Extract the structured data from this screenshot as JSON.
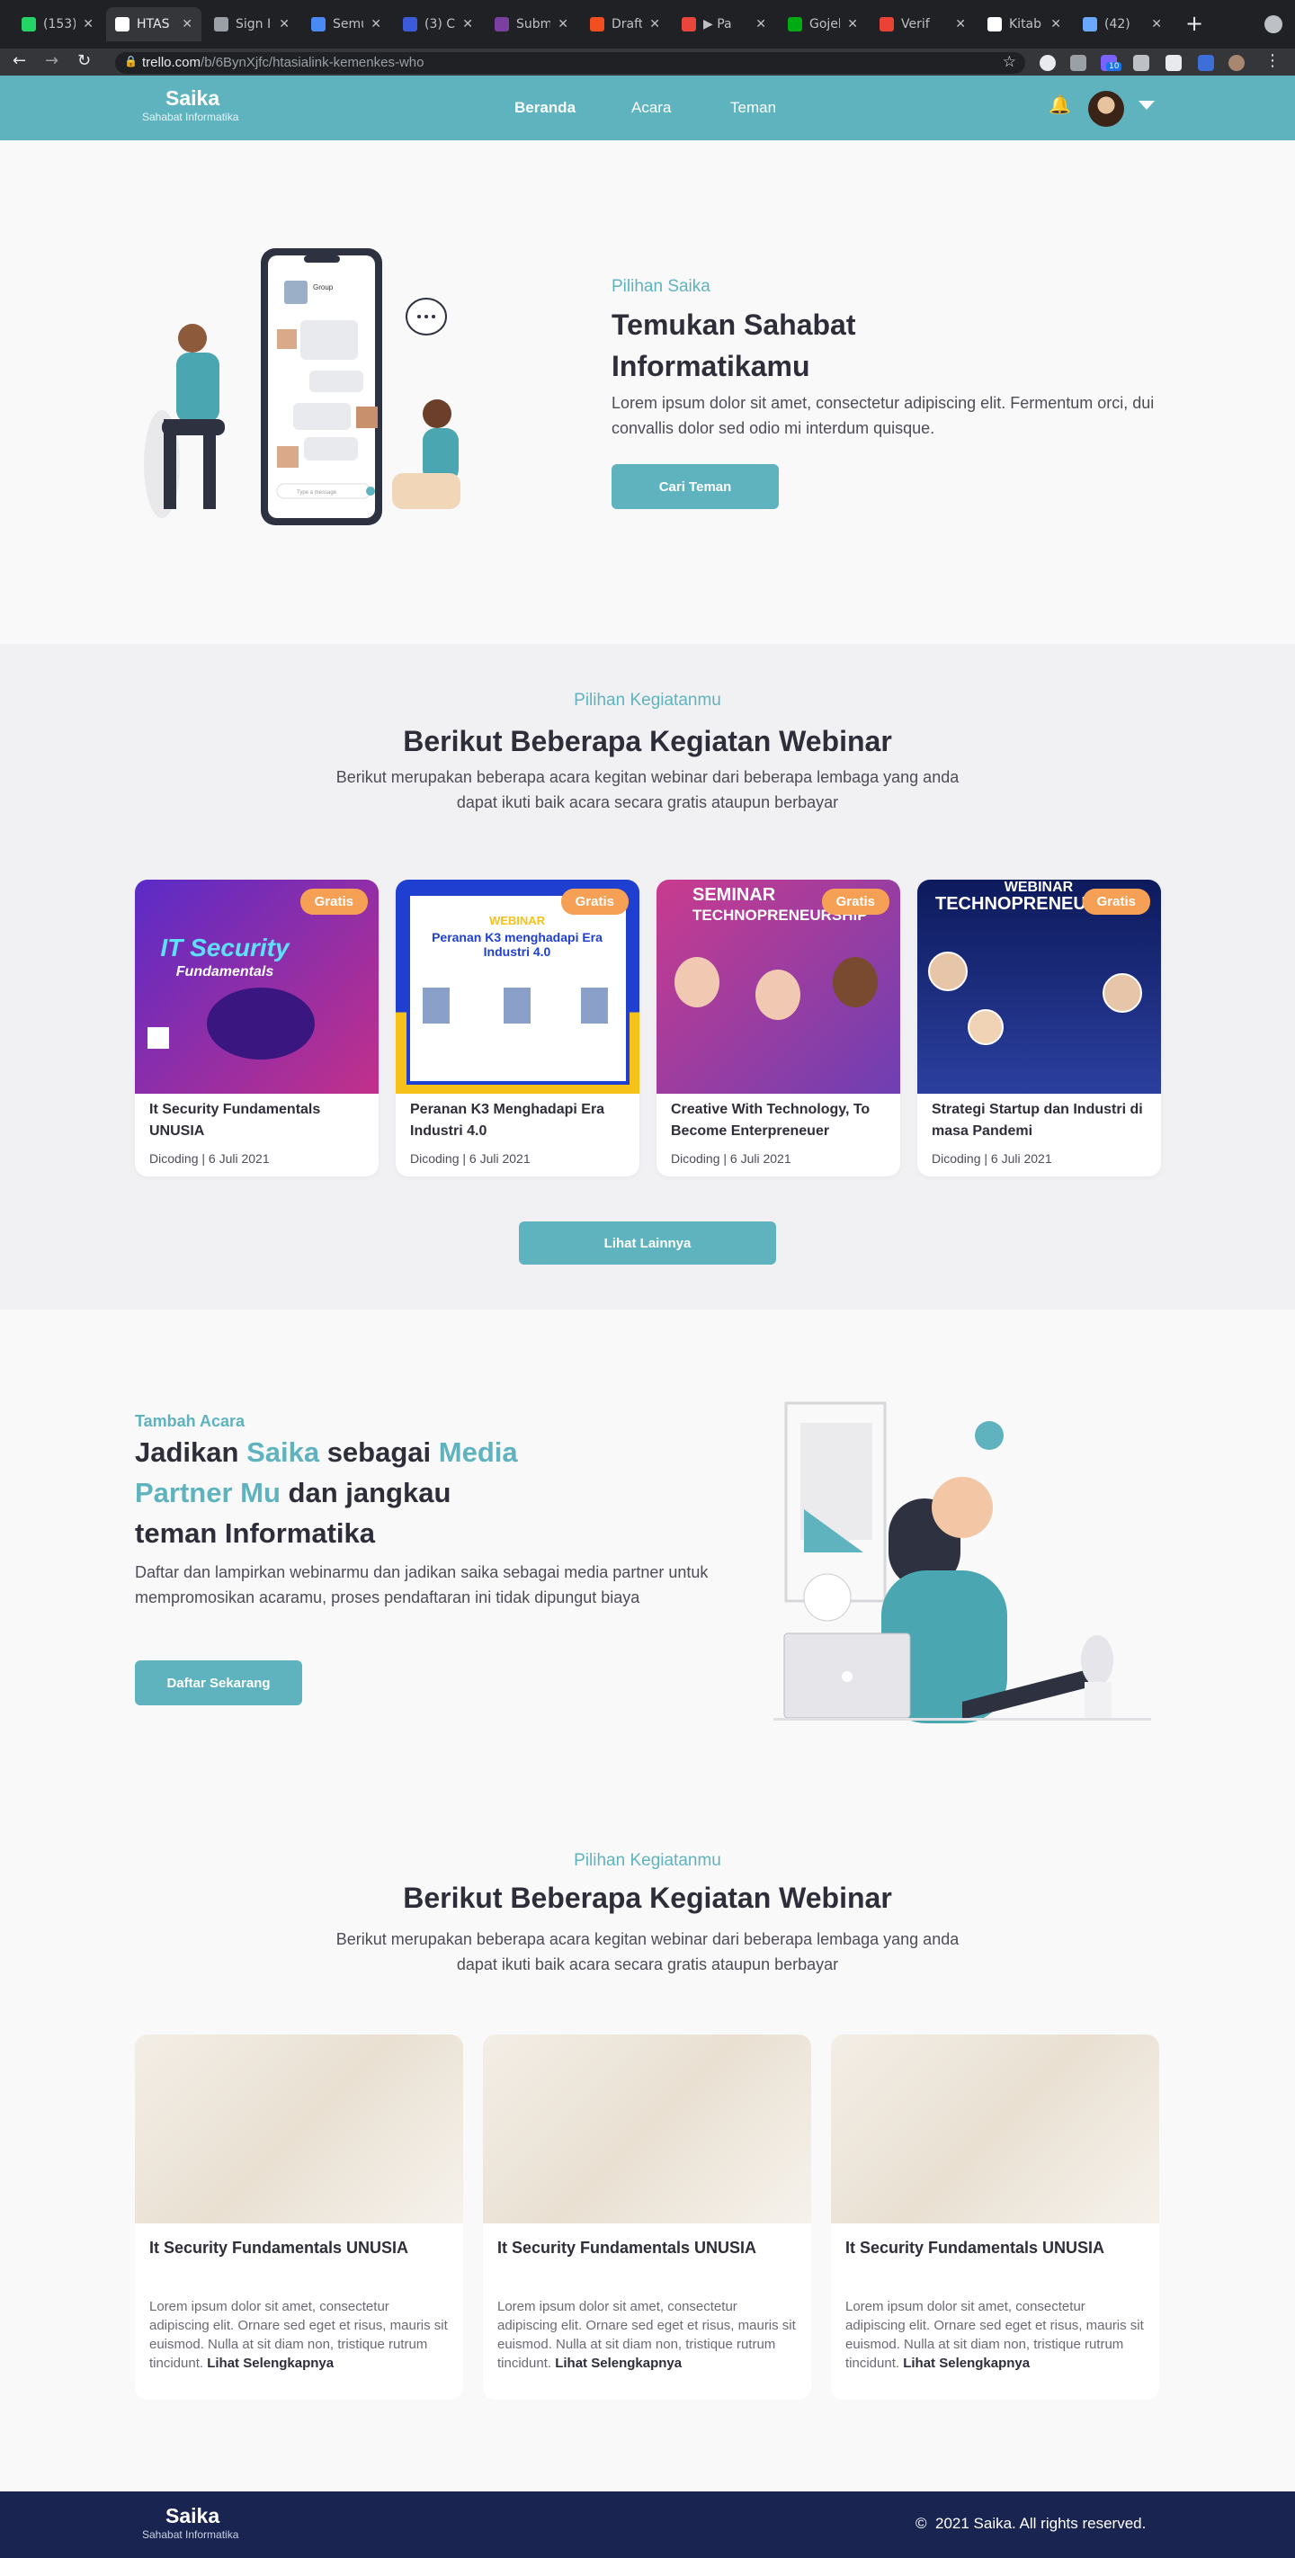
{
  "browser": {
    "tabs": [
      {
        "label": "(153)",
        "color": "#25d366"
      },
      {
        "label": "HTAS",
        "color": "#ffffff"
      },
      {
        "label": "Sign I",
        "color": "#9aa0a6"
      },
      {
        "label": "Semu",
        "color": "#4a8af4"
      },
      {
        "label": "(3) C",
        "color": "#3b5bdb"
      },
      {
        "label": "Subm",
        "color": "#7b3fa0"
      },
      {
        "label": "Draft",
        "color": "#f24e1e"
      },
      {
        "label": "▶ Pa",
        "color": "#e8453c"
      },
      {
        "label": "Gojek",
        "color": "#00aa13"
      },
      {
        "label": "Verif",
        "color": "#ea4335"
      },
      {
        "label": "Kitab",
        "color": "#ffffff"
      },
      {
        "label": "(42)",
        "color": "#6aa9ff"
      }
    ],
    "url_host": "trello.com",
    "url_path": "/b/6BynXjfc/htasialink-kemenkes-who",
    "extension_badge": "10"
  },
  "header": {
    "brand": "Saika",
    "brand_sub": "Sahabat Informatika",
    "nav": [
      "Beranda",
      "Acara",
      "Teman"
    ]
  },
  "hero": {
    "eyebrow": "Pilihan Saika",
    "title_line1": "Temukan Sahabat",
    "title_line2": "Informatikamu",
    "desc": "Lorem ipsum dolor sit amet, consectetur adipiscing elit. Fermentum orci, dui convallis dolor sed odio mi interdum quisque.",
    "cta": "Cari Teman",
    "chat_app_title": "Group",
    "chat_input_placeholder": "Type a message"
  },
  "webinar": {
    "eyebrow": "Pilihan Kegiatanmu",
    "title": "Berikut Beberapa Kegiatan Webinar",
    "desc_line1": "Berikut merupakan beberapa acara kegitan webinar dari beberapa lembaga yang anda",
    "desc_line2": "dapat ikuti baik acara secara gratis ataupun berbayar",
    "badge": "Gratis",
    "cards": [
      {
        "poster_text": "IT Security",
        "poster_sub": "Fundamentals",
        "title": "It Security Fundamentals UNUSIA",
        "meta": "Dicoding | 6 Juli 2021",
        "c1": "#5b2bc7",
        "c2": "#c2308a"
      },
      {
        "poster_text": "WEBINAR",
        "poster_sub": "Peranan K3 menghadapi Era Industri 4.0",
        "title": "Peranan K3 Menghadapi Era Industri 4.0",
        "meta": "Dicoding | 6 Juli 2021",
        "c1": "#1f3fd1",
        "c2": "#f6c21a"
      },
      {
        "poster_text": "SEMINAR",
        "poster_sub": "TECHNOPRENEURSHIP",
        "title": "Creative With Technology, To Become Enterpreneuer",
        "meta": "Dicoding | 6 Juli 2021",
        "c1": "#c93b8e",
        "c2": "#6e3fb3"
      },
      {
        "poster_text": "WEBINAR",
        "poster_sub": "TECHNOPRENEUR",
        "title": "Strategi Startup dan Industri di masa Pandemi",
        "meta": "Dicoding | 6 Juli 2021",
        "c1": "#0d1a5c",
        "c2": "#2b3f9e"
      }
    ],
    "more": "Lihat Lainnya"
  },
  "partner": {
    "eyebrow": "Tambah Acara",
    "t1": "Jadikan ",
    "t2": "Saika",
    "t3": " sebagai ",
    "t4": "Media",
    "t5": "Partner Mu",
    "t6": " dan jangkau",
    "t7": "teman Informatika",
    "desc": "Daftar dan lampirkan webinarmu dan jadikan saika sebagai media partner untuk mempromosikan acaramu, proses pendaftaran ini tidak dipungut biaya",
    "cta": "Daftar Sekarang"
  },
  "articles": {
    "eyebrow": "Pilihan Kegiatanmu",
    "title": "Berikut Beberapa Kegiatan Webinar",
    "desc_line1": "Berikut merupakan beberapa acara kegitan webinar dari beberapa lembaga yang anda",
    "desc_line2": "dapat ikuti baik acara secara gratis ataupun berbayar",
    "items": [
      {
        "title": "It Security Fundamentals UNUSIA",
        "desc": "Lorem ipsum dolor sit amet, consectetur adipiscing elit. Ornare sed eget et risus, mauris sit euismod. Nulla at sit diam non, tristique rutrum tincidunt.",
        "link": "Lihat Selengkapnya"
      },
      {
        "title": "It Security Fundamentals UNUSIA",
        "desc": "Lorem ipsum dolor sit amet, consectetur adipiscing elit. Ornare sed eget et risus, mauris sit euismod. Nulla at sit diam non, tristique rutrum tincidunt.",
        "link": "Lihat Selengkapnya"
      },
      {
        "title": "It Security Fundamentals UNUSIA",
        "desc": "Lorem ipsum dolor sit amet, consectetur adipiscing elit. Ornare sed eget et risus, mauris sit euismod. Nulla at sit diam non, tristique rutrum tincidunt.",
        "link": "Lihat Selengkapnya"
      }
    ]
  },
  "footer": {
    "brand": "Saika",
    "brand_sub": "Sahabat Informatika",
    "copyright_symbol": "©",
    "copyright": "2021 Saika. All rights reserved."
  }
}
